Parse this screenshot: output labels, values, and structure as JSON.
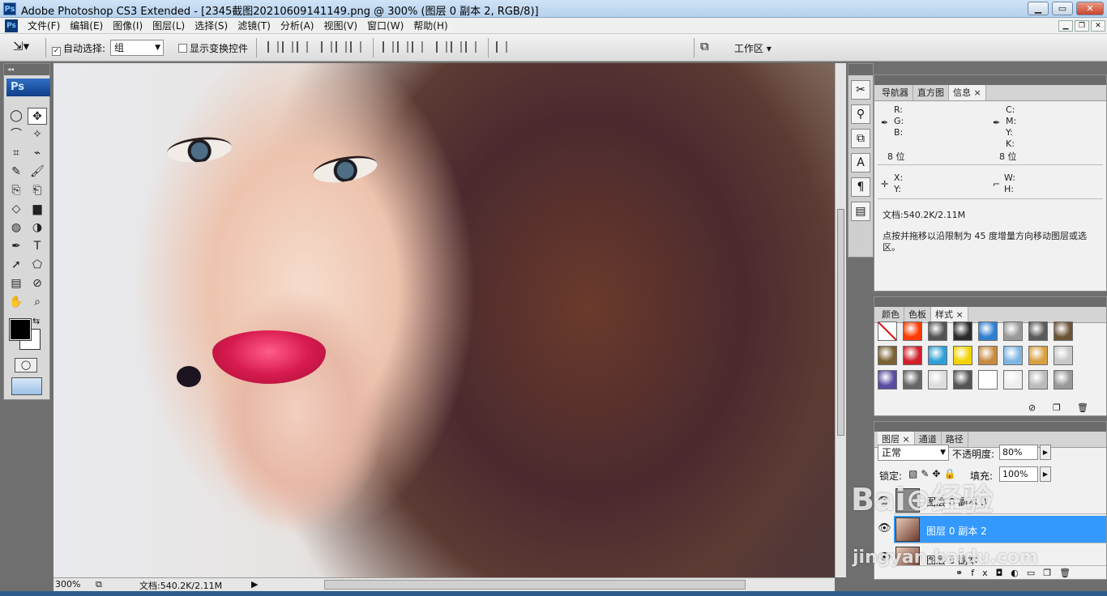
{
  "window": {
    "title": "Adobe Photoshop CS3 Extended - [2345截图20210609141149.png @ 300% (图层 0 副本 2, RGB/8)]",
    "app_logo": "Ps",
    "min_label": "▁",
    "max_label": "▭",
    "close_label": "✕"
  },
  "menu": [
    "文件(F)",
    "编辑(E)",
    "图像(I)",
    "图层(L)",
    "选择(S)",
    "滤镜(T)",
    "分析(A)",
    "视图(V)",
    "窗口(W)",
    "帮助(H)"
  ],
  "options": {
    "auto_select_label": "自动选择:",
    "auto_select_value": "组",
    "show_transform_label": "显示变换控件",
    "workspace_label": "工作区 ▾"
  },
  "tools": {
    "logo": "Ps",
    "items": [
      "◯",
      "✥",
      "⌒",
      "✧",
      "⌗",
      "⌁",
      "✎",
      "🖌",
      "⎘",
      "⎗",
      "◇",
      "▆",
      "◍",
      "◑",
      "✒",
      "T",
      "➚",
      "⬠",
      "▤",
      "⊘",
      "✋",
      "⌕"
    ]
  },
  "info_panel": {
    "tabs": [
      "导航器",
      "直方图",
      "信息 ×"
    ],
    "r": "R:",
    "g": "G:",
    "b": "B:",
    "c": "C:",
    "m": "M:",
    "y": "Y:",
    "k": "K:",
    "bits_left": "8 位",
    "bits_right": "8 位",
    "x": "X:",
    "yy": "Y:",
    "w": "W:",
    "h": "H:",
    "doc": "文档:540.2K/2.11M",
    "hint": "点按并拖移以沿限制为 45 度增量方向移动图层或选区。"
  },
  "styles_panel": {
    "tabs": [
      "颜色",
      "色板",
      "样式 ×"
    ],
    "swatch_colors": [
      "#ffffff",
      "#ff3a00",
      "#555555",
      "#2b2b2b",
      "#2f7fd1",
      "#9a9a9a",
      "#5a5a5a",
      "#6b5436",
      "#7a6032",
      "#d0202a",
      "#2ea0d8",
      "#f2d300",
      "#c98a40",
      "#7fb5e4",
      "#d7a040",
      "#c8c8c8",
      "#5a4aa0",
      "#666666",
      "#dddddd",
      "#555555",
      "#ffffff",
      "#eeeeee",
      "#bbbbbb",
      "#999999"
    ]
  },
  "layers_panel": {
    "tabs": [
      "图层 ×",
      "通道",
      "路径"
    ],
    "blend_mode": "正常",
    "opacity_label": "不透明度:",
    "opacity_value": "80%",
    "lock_label": "锁定:",
    "fill_label": "填充:",
    "fill_value": "100%",
    "layers": [
      {
        "name": "图层 0 副本 3",
        "active": false
      },
      {
        "name": "图层 0 副本 2",
        "active": true
      },
      {
        "name": "图层 0 副本",
        "active": false
      }
    ]
  },
  "status": {
    "zoom": "300%",
    "doc": "文档:540.2K/2.11M"
  },
  "watermark": {
    "line1": "Bai⊕经验",
    "line2": "jingyan.baidu.com"
  }
}
